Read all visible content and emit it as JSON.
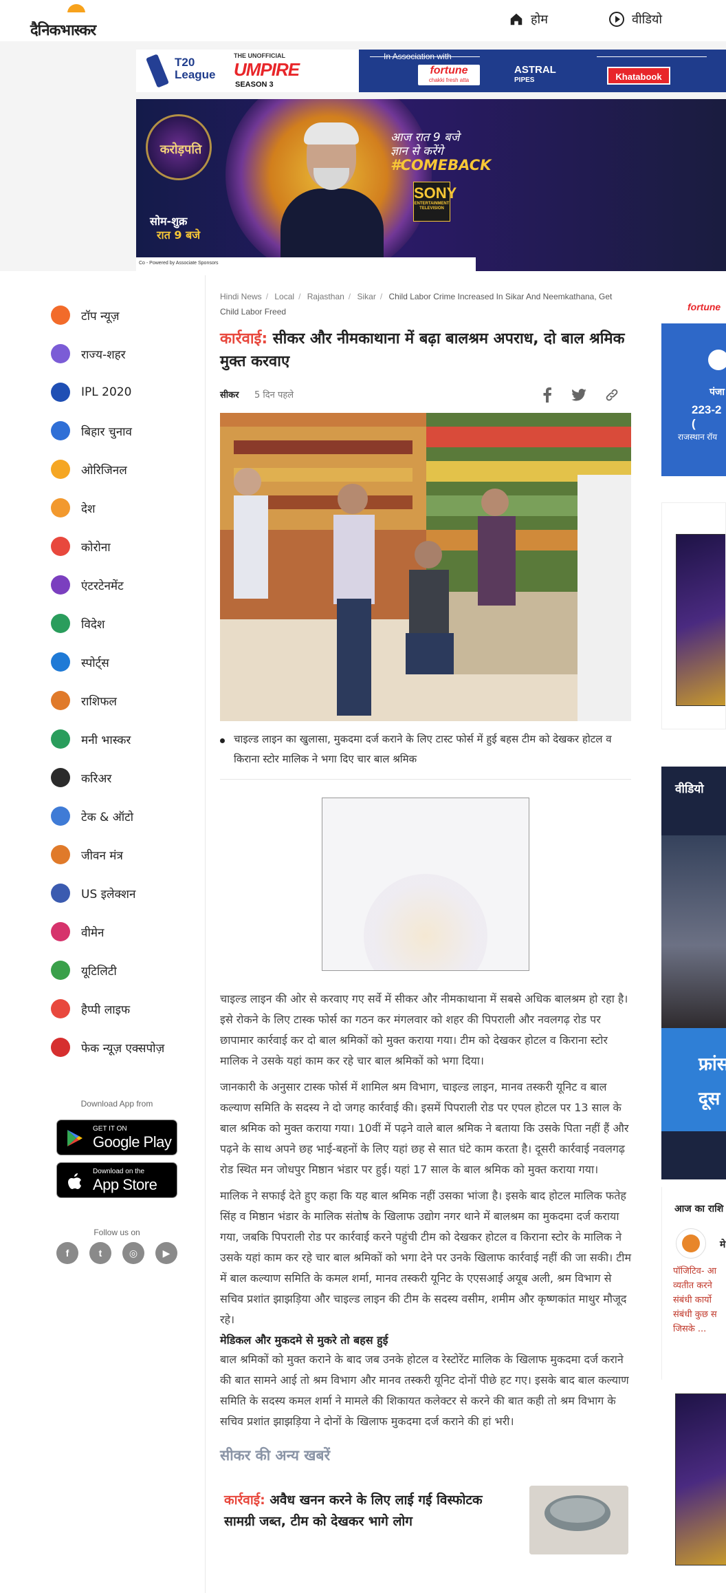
{
  "header": {
    "logo_text": "दैनिकभास्कर",
    "nav": [
      {
        "label": "होम",
        "icon": "home-icon"
      },
      {
        "label": "वीडियो",
        "icon": "play-circle-icon"
      }
    ]
  },
  "top_ad": {
    "league_text": "T20 League",
    "umpire_small": "THE UNOFFICIAL",
    "umpire_big": "UMPIRE",
    "season": "SEASON 3",
    "association": "In Association with",
    "fortune": "fortune",
    "fortune_tag": "chakki fresh atta",
    "astral": "ASTRAL",
    "astral_sub": "PIPES",
    "khatabook": "Khatabook"
  },
  "kbc_ad": {
    "logo_text": "करोड़पति",
    "line1": "आज रात 9 बजे",
    "line2": "ज्ञान से करेंगे",
    "hashtag": "#COMEBACK",
    "channel": "SONY",
    "channel_sub": "ENTERTAINMENT TELEVISION",
    "days": "सोम-शुक्र",
    "time": "रात 9 बजे",
    "sponsor_line": "Co - Powered by      Associate Sponsors"
  },
  "sidebar": {
    "items": [
      {
        "label": "टॉप न्यूज़",
        "icon": "fire-icon",
        "color": "#f26b2a"
      },
      {
        "label": "राज्य-शहर",
        "icon": "city-buildings-icon",
        "color": "#7b5cd6"
      },
      {
        "label": "IPL 2020",
        "icon": "cricket-player-icon",
        "color": "#1f4fb4"
      },
      {
        "label": "बिहार चुनाव",
        "icon": "voting-hand-icon",
        "color": "#2f6fd6"
      },
      {
        "label": "ओरिजिनल",
        "icon": "original-badge-icon",
        "color": "#f5a623"
      },
      {
        "label": "देश",
        "icon": "india-map-icon",
        "color": "#f2992e"
      },
      {
        "label": "कोरोना",
        "icon": "virus-icon",
        "color": "#e8483d"
      },
      {
        "label": "एंटरटेनमेंट",
        "icon": "clapperboard-icon",
        "color": "#7b3fbf"
      },
      {
        "label": "विदेश",
        "icon": "globe-icon",
        "color": "#2a9d5c"
      },
      {
        "label": "स्पोर्ट्स",
        "icon": "runner-icon",
        "color": "#1f7ad6"
      },
      {
        "label": "राशिफल",
        "icon": "zodiac-wheel-icon",
        "color": "#e07a2a"
      },
      {
        "label": "मनी भास्कर",
        "icon": "rupee-coin-icon",
        "color": "#2a9d5c"
      },
      {
        "label": "करिअर",
        "icon": "graduation-cap-icon",
        "color": "#2b2b2b"
      },
      {
        "label": "टेक & ऑटो",
        "icon": "car-tech-icon",
        "color": "#3f7bd6"
      },
      {
        "label": "जीवन मंत्र",
        "icon": "temple-icon",
        "color": "#e07a2a"
      },
      {
        "label": "US इलेक्शन",
        "icon": "us-flag-icon",
        "color": "#3b5bb0"
      },
      {
        "label": "वीमेन",
        "icon": "women-icon",
        "color": "#d6336c"
      },
      {
        "label": "यूटिलिटी",
        "icon": "lightbulb-icon",
        "color": "#3aa04a"
      },
      {
        "label": "हैप्पी लाइफ",
        "icon": "hearts-icon",
        "color": "#e8483d"
      },
      {
        "label": "फेक न्यूज़ एक्सपोज़",
        "icon": "fake-news-icon",
        "color": "#d62f2f"
      }
    ],
    "download_label": "Download App from",
    "google_small": "GET IT ON",
    "google_big": "Google Play",
    "apple_small": "Download on the",
    "apple_big": "App Store",
    "follow_label": "Follow us on",
    "socials": [
      {
        "name": "facebook-icon",
        "glyph": "f"
      },
      {
        "name": "twitter-icon",
        "glyph": "t"
      },
      {
        "name": "instagram-icon",
        "glyph": "◎"
      },
      {
        "name": "youtube-icon",
        "glyph": "▶"
      }
    ]
  },
  "article": {
    "breadcrumb": [
      "Hindi News",
      "Local",
      "Rajasthan",
      "Sikar",
      "Child Labor Crime Increased In Sikar And Neemkathana, Get Child Labor Freed"
    ],
    "kicker": "कार्रवाई:",
    "title": " सीकर और नीमकाथाना में बढ़ा बालश्रम अपराध, दो बाल श्रमिक मुक्त करवाए",
    "location": "सीकर",
    "time": "5 दिन पहले",
    "caption": "चाइल्ड लाइन का खुलासा, मुकदमा दर्ज कराने के लिए टास्ट फोर्स में हुई बहस टीम को देखकर होटल व किराना स्टोर मालिक ने भगा दिए चार बाल श्रमिक",
    "paragraphs": [
      "चाइल्ड लाइन की ओर से करवाए गए सर्वे में सीकर और नीमकाथाना में सबसे अधिक बालश्रम हो रहा है। इसे रोकने के लिए टास्क फोर्स का गठन कर मंगलवार को शहर की पिपराली और नवलगढ़ रोड पर छापामार कार्रवाई कर दो बाल श्रमिकों को मुक्त कराया गया। टीम को देखकर होटल व किराना स्टोर मालिक ने उसके यहां काम कर रहे चार बाल श्रमिकों को भगा दिया।",
      "जानकारी के अनुसार टास्क फोर्स में शामिल श्रम विभाग, चाइल्ड लाइन, मानव तस्करी यूनिट व बाल कल्याण समिति के सदस्य ने दो जगह कार्रवाई की। इसमें पिपराली रोड पर एपल होटल पर 13 साल के बाल श्रमिक को मुक्त कराया गया। 10वीं में पढ़ने वाले बाल श्रमिक ने बताया कि उसके पिता नहीं हैं और पढ़ने के साथ अपने छह भाई-बहनों के लिए यहां छह से सात घंटे काम करता है। दूसरी कार्रवाई नवलगढ़ रोड स्थित मन जोधपुर मिष्ठान भंडार पर हुई। यहां 17 साल के बाल श्रमिक को मुक्त कराया गया।",
      "मालिक ने सफाई देते हुए कहा कि यह बाल श्रमिक नहीं उसका भांजा है। इसके बाद होटल मालिक फतेह सिंह व मिष्ठान भंडार के मालिक संतोष के खिलाफ उद्योग नगर थाने में बालश्रम का मुकदमा दर्ज कराया गया, जबकि पिपराली रोड पर कार्रवाई करने पहुंची टीम को देखकर होटल व किराना स्टोर के मालिक ने उसके यहां काम कर रहे चार बाल श्रमिकों को भगा देने पर उनके खिलाफ कार्रवाई नहीं की जा सकी। टीम में बाल कल्याण समिति के कमल शर्मा, मानव तस्करी यूनिट के एएसआई अयूब अली, श्रम विभाग से सचिव प्रशांत झाझड़िया और चाइल्ड लाइन की टीम के सदस्य वसीम, शमीम और कृष्णकांत माथुर मौजूद रहे।"
    ],
    "subheading": "मेडिकल और मुकदमे से मुकरे तो बहस हुई",
    "last_paragraph": "बाल श्रमिकों को मुक्त कराने के बाद जब उनके होटल व रेस्टोरेंट मालिक के खिलाफ मुकदमा दर्ज कराने की बात सामने आई तो श्रम विभाग और मानव तस्करी यूनिट दोनों पीछे हट गए। इसके बाद बाल कल्याण समिति के सदस्य कमल शर्मा ने मामले की शिकायत कलेक्टर से करने की बात कही तो श्रम विभाग के सचिव प्रशांत झाझड़िया ने दोनों के खिलाफ मुकदमा दर्ज कराने की हां भरी।",
    "more_title": "सीकर की अन्य खबरें",
    "more_items": [
      {
        "kicker": "कार्रवाई:",
        "title": " अवैध खनन करने के लिए लाई गई विस्फोटक सामग्री जब्त, टीम को देखकर भागे लोग"
      }
    ]
  },
  "right_rail": {
    "card1_brand": "fortune",
    "card1_title": "पंजा",
    "card1_score": "223-2 (",
    "card1_team": "राजस्थान रॉय",
    "video_title": "वीडियो",
    "video_banner_1": "फ्रांस",
    "video_banner_2": "दूस",
    "rashifal_title": "आज का राशि",
    "rashifal_sign": "मे",
    "rashifal_text": [
      "पॉजिटिव- आ",
      "व्यतीत करने",
      "संबंधी कार्यो",
      "संबंधी कुछ स",
      "जिसके ..."
    ]
  },
  "colors": {
    "accent": "#e8483d",
    "text": "#222222",
    "muted": "#777777",
    "link_blue": "#1f3c8c"
  }
}
